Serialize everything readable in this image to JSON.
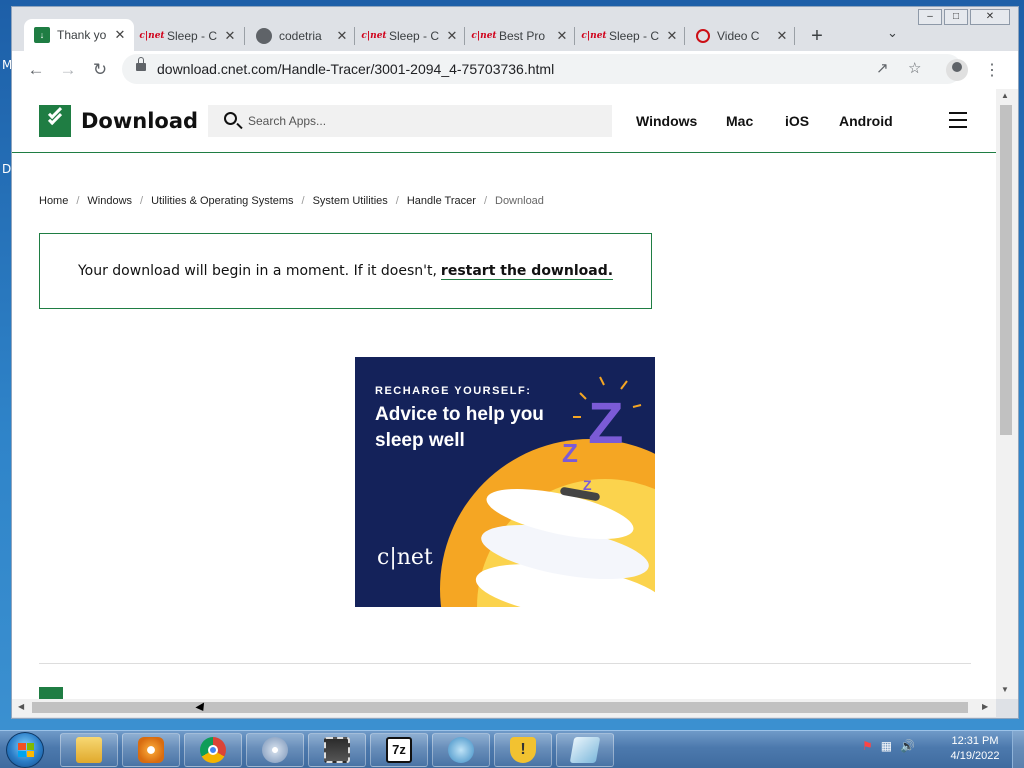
{
  "desktop": {
    "left_letters": [
      "M",
      "D"
    ]
  },
  "browser": {
    "tabs": [
      {
        "title": "Thank yo",
        "favicon": "download-favicon",
        "active": true
      },
      {
        "title": "Sleep - C",
        "favicon": "cnet-favicon",
        "active": false
      },
      {
        "title": "codetria",
        "favicon": "globe-favicon",
        "active": false
      },
      {
        "title": "Sleep - C",
        "favicon": "cnet-favicon",
        "active": false
      },
      {
        "title": "Best Pro",
        "favicon": "cnet-favicon",
        "active": false
      },
      {
        "title": "Sleep - C",
        "favicon": "cnet-favicon",
        "active": false
      },
      {
        "title": "Video C",
        "favicon": "opera-favicon",
        "active": false
      }
    ],
    "url": "download.cnet.com/Handle-Tracer/3001-2094_4-75703736.html"
  },
  "site": {
    "logo_text": "Download",
    "search_placeholder": "Search Apps...",
    "nav": [
      "Windows",
      "Mac",
      "iOS",
      "Android"
    ],
    "breadcrumb": [
      "Home",
      "Windows",
      "Utilities & Operating Systems",
      "System Utilities",
      "Handle Tracer",
      "Download"
    ],
    "notice": {
      "text": "Your download will begin in a moment. If it doesn't,",
      "link": "restart the download."
    },
    "ad": {
      "kicker": "RECHARGE YOURSELF:",
      "headline": "Advice to help you sleep well",
      "brand": "c|net",
      "colors": {
        "background": "#14225a",
        "sun": "#f5a623",
        "z": "#7b5bd6"
      }
    }
  },
  "taskbar": {
    "apps": [
      "file-explorer",
      "media-player",
      "chrome",
      "dvd-app",
      "film-editor",
      "7zip",
      "network-app",
      "security-app",
      "notepad-app"
    ],
    "clock_time": "12:31 PM",
    "clock_date": "4/19/2022"
  },
  "colors": {
    "accent": "#1f7d43"
  }
}
